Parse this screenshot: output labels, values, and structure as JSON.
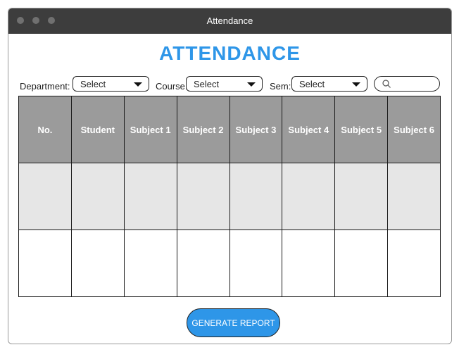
{
  "colors": {
    "titlebar": "#3d3d3d",
    "accent": "#2e96e8",
    "header_bg": "#9b9b9b",
    "row_shaded": "#e6e6e6"
  },
  "window": {
    "title": "Attendance"
  },
  "page": {
    "heading": "ATTENDANCE"
  },
  "filters": {
    "department": {
      "label": "Department:",
      "value": "Select"
    },
    "course": {
      "label": "Course:",
      "value": "Select"
    },
    "sem": {
      "label": "Sem:",
      "value": "Select"
    },
    "search": {
      "icon": "search-icon",
      "value": ""
    }
  },
  "table": {
    "headers": [
      "No.",
      "Student",
      "Subject 1",
      "Subject 2",
      "Subject 3",
      "Subject 4",
      "Subject 5",
      "Subject 6"
    ],
    "rows": [
      [
        "",
        "",
        "",
        "",
        "",
        "",
        "",
        ""
      ],
      [
        "",
        "",
        "",
        "",
        "",
        "",
        "",
        ""
      ]
    ]
  },
  "actions": {
    "generate_label": "GENERATE REPORT"
  }
}
